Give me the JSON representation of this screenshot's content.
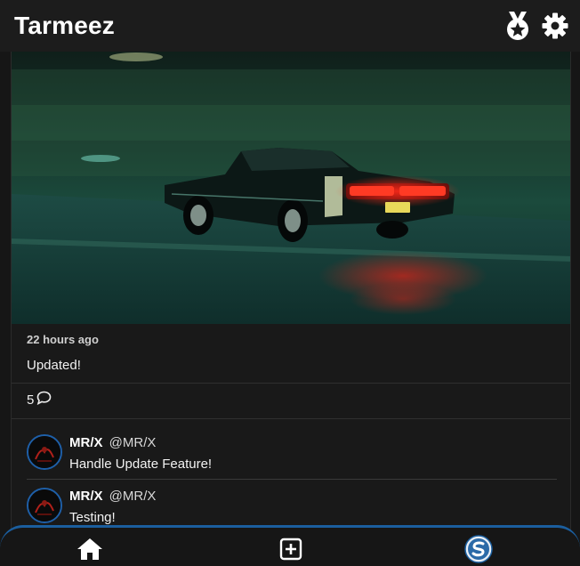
{
  "app": {
    "title": "Tarmeez"
  },
  "topbar": {
    "badge_icon": "medal-star-icon",
    "settings_icon": "gear-icon"
  },
  "post": {
    "image_alt": "Classic muscle car driving at night",
    "time": "22 hours ago",
    "body": "Updated!",
    "comment_count": "5",
    "comment_icon": "chat-bubble-icon"
  },
  "comments": [
    {
      "name": "MR/X",
      "handle": "@MR/X",
      "text": "Handle Update Feature!"
    },
    {
      "name": "MR/X",
      "handle": "@MR/X",
      "text": "Testing!"
    }
  ],
  "bottom_nav": {
    "items": [
      {
        "icon": "home-icon"
      },
      {
        "icon": "add-post-icon"
      },
      {
        "icon": "profile-avatar-icon"
      }
    ],
    "accent": "#1b5e9e"
  },
  "colors": {
    "background": "#161616",
    "topbar": "#1c1c1c",
    "avatar_border": "#1e5fa8"
  }
}
